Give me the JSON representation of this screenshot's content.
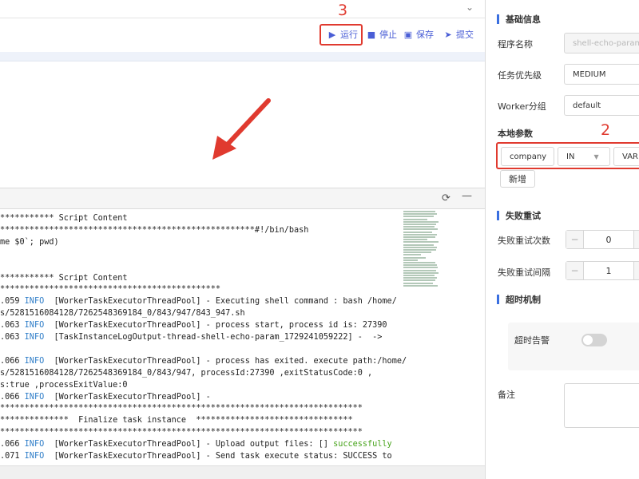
{
  "toolbar": {
    "run_label": "运行",
    "stop_label": "停止",
    "save_label": "保存",
    "submit_label": "提交"
  },
  "annotations": {
    "run_step": "3",
    "params_step": "2"
  },
  "log": {
    "lines": [
      {
        "text": "*********** Script Content"
      },
      {
        "text": "****************************************************#!/bin/bash"
      },
      {
        "text": "me $0`; pwd)"
      },
      {
        "text": ""
      },
      {
        "text": ""
      },
      {
        "text": "*********** Script Content"
      },
      {
        "text": "*********************************************"
      },
      {
        "prefix": ".059 ",
        "level": "INFO",
        "msg": "  [WorkerTaskExecutorThreadPool] - Executing shell command : bash /home/"
      },
      {
        "text": "s/5281516084128/7262548369184_0/843/947/843_947.sh"
      },
      {
        "prefix": ".063 ",
        "level": "INFO",
        "msg": "  [WorkerTaskExecutorThreadPool] - process start, process id is: 27390"
      },
      {
        "prefix": ".063 ",
        "level": "INFO",
        "msg": "  [TaskInstanceLogOutput-thread-shell-echo-param_1729241059222] -  ->"
      },
      {
        "text": ""
      },
      {
        "prefix": ".066 ",
        "level": "INFO",
        "msg": "  [WorkerTaskExecutorThreadPool] - process has exited. execute path:/home/"
      },
      {
        "text": "s/5281516084128/7262548369184_0/843/947, processId:27390 ,exitStatusCode:0 ,"
      },
      {
        "text": "s:true ,processExitValue:0"
      },
      {
        "prefix": ".066 ",
        "level": "INFO",
        "msg": "  [WorkerTaskExecutorThreadPool] -"
      },
      {
        "text": "**************************************************************************"
      },
      {
        "text": "**************  Finalize task instance  ********************************"
      },
      {
        "text": "**************************************************************************"
      },
      {
        "prefix": ".066 ",
        "level": "INFO",
        "msg": "  [WorkerTaskExecutorThreadPool] - Upload output files: [] ",
        "ok": "successfully"
      },
      {
        "prefix": ".071 ",
        "level": "INFO",
        "msg": "  [WorkerTaskExecutorThreadPool] - Send task execute status: SUCCESS to"
      }
    ]
  },
  "form": {
    "basic_title": "基础信息",
    "program_name_label": "程序名称",
    "program_name_value": "shell-echo-param",
    "priority_label": "任务优先级",
    "priority_value": "MEDIUM",
    "worker_group_label": "Worker分组",
    "worker_group_value": "default",
    "local_params_label": "本地参数",
    "param_key": "company",
    "param_direction": "IN",
    "param_type": "VAR",
    "add_label": "新增",
    "retry_title": "失败重试",
    "retry_times_label": "失败重试次数",
    "retry_times_value": "0",
    "retry_interval_label": "失败重试间隔",
    "retry_interval_value": "1",
    "timeout_title": "超时机制",
    "timeout_alert_label": "超时告警",
    "remark_label": "备注"
  },
  "colors": {
    "accent": "#4a5ed6",
    "annotation": "#e03a2f",
    "info": "#2e7dc8",
    "success": "#46a31a"
  }
}
